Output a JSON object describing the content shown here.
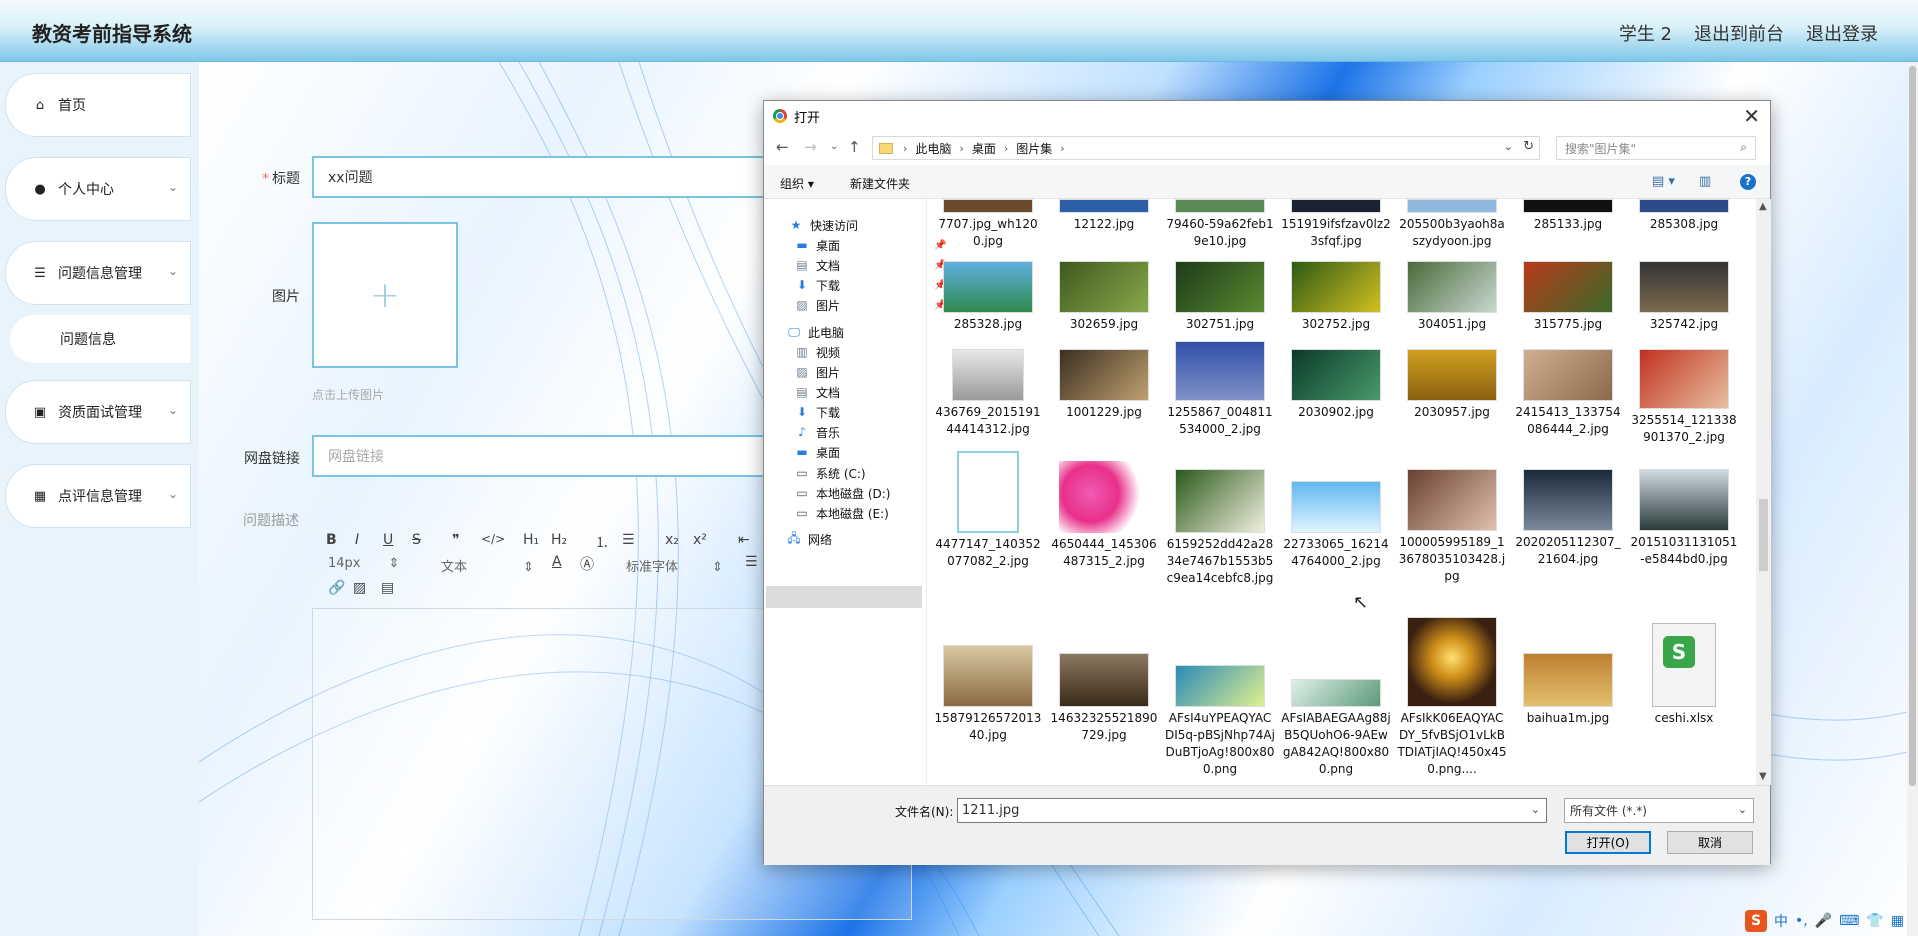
{
  "header": {
    "title": "教资考前指导系统",
    "nav": [
      "学生 2",
      "退出到前台",
      "退出登录"
    ]
  },
  "sidebar": {
    "items": [
      {
        "label": "首页",
        "icon": "home-icon"
      },
      {
        "label": "个人中心",
        "icon": "user-icon"
      },
      {
        "label": "问题信息管理",
        "icon": "list-icon"
      },
      {
        "label": "问题信息",
        "icon": ""
      },
      {
        "label": "资质面试管理",
        "icon": "briefcase-icon"
      },
      {
        "label": "点评信息管理",
        "icon": "grid-icon"
      }
    ]
  },
  "form": {
    "title_label": "标题",
    "title_value": "xx问题",
    "image_label": "图片",
    "upload_hint": "点击上传图片",
    "link_label": "网盘链接",
    "link_placeholder": "网盘链接",
    "desc_label": "问题描述",
    "editor": {
      "font_size": "14px",
      "text_style": "文本",
      "font_family": "标准字体"
    }
  },
  "dialog": {
    "title": "打开",
    "breadcrumb": [
      "此电脑",
      "桌面",
      "图片集"
    ],
    "search_placeholder": "搜索\"图片集\"",
    "organize": "组织 ▾",
    "new_folder": "新建文件夹",
    "nav_pane": [
      {
        "label": "快速访问",
        "icon": "star-icon",
        "pin": false
      },
      {
        "label": "桌面",
        "icon": "desktop-icon",
        "pin": true
      },
      {
        "label": "文档",
        "icon": "document-icon",
        "pin": true
      },
      {
        "label": "下载",
        "icon": "download-icon",
        "pin": true
      },
      {
        "label": "图片",
        "icon": "picture-icon",
        "pin": true
      },
      {
        "label": "此电脑",
        "icon": "computer-icon",
        "pin": false
      },
      {
        "label": "视频",
        "icon": "video-icon",
        "pin": false
      },
      {
        "label": "图片",
        "icon": "picture-icon",
        "pin": false
      },
      {
        "label": "文档",
        "icon": "document-icon",
        "pin": false
      },
      {
        "label": "下载",
        "icon": "download-icon",
        "pin": false
      },
      {
        "label": "音乐",
        "icon": "music-icon",
        "pin": false
      },
      {
        "label": "桌面",
        "icon": "desktop-icon",
        "pin": false
      },
      {
        "label": "系统 (C:)",
        "icon": "drive-icon",
        "pin": false
      },
      {
        "label": "本地磁盘 (D:)",
        "icon": "drive-icon",
        "pin": false
      },
      {
        "label": "本地磁盘 (E:)",
        "icon": "drive-icon",
        "pin": false
      },
      {
        "label": "网络",
        "icon": "network-icon",
        "pin": false
      }
    ],
    "files": [
      [
        "7707.jpg_wh1200.jpg",
        "12122.jpg",
        "79460-59a62feb19e10.jpg",
        "151919ifsfzav0lz23sfqf.jpg",
        "205500b3yaoh8aszydyoon.jpg",
        "285133.jpg",
        "285308.jpg"
      ],
      [
        "285328.jpg",
        "302659.jpg",
        "302751.jpg",
        "302752.jpg",
        "304051.jpg",
        "315775.jpg",
        "325742.jpg"
      ],
      [
        "436769_201519144414312.jpg",
        "1001229.jpg",
        "1255867_004811534000_2.jpg",
        "2030902.jpg",
        "2030957.jpg",
        "2415413_133754086444_2.jpg",
        "3255514_121338901370_2.jpg"
      ],
      [
        "4477147_140352077082_2.jpg",
        "4650444_145306487315_2.jpg",
        "6159252dd42a2834e7467b1553b5c9ea14cebfc8.jpg",
        "22733065_162144764000_2.jpg",
        "100005995189_13678035103428.jpg",
        "2020205112307_21604.jpg",
        "20151031131051-e5844bd0.jpg"
      ],
      [
        "15879126572013 40.jpg",
        "14632325521890729.jpg",
        "AFsI4uYPEAQYACDI5q-pBSjNhp74AjDuBTjoAg!800x800.png",
        "AFsIABAEGAAg88jB5QUohO6-9AEwgA842AQ!800x800.png",
        "AFsIkK06EAQYACDY_5fvBSjO1vLkBTDIATjIAQ!450x450.png....",
        "baihua1m.jpg",
        "ceshi.xlsx"
      ]
    ],
    "filename_label": "文件名(N):",
    "filename_value": "1211.jpg",
    "filetype": "所有文件 (*.*)",
    "open_button": "打开(O)",
    "cancel_button": "取消"
  },
  "ime": {
    "lang": "中"
  },
  "colors": {
    "accent": "#78c3e6",
    "required": "#f56c6c",
    "primary_btn_border": "#0078d7"
  }
}
